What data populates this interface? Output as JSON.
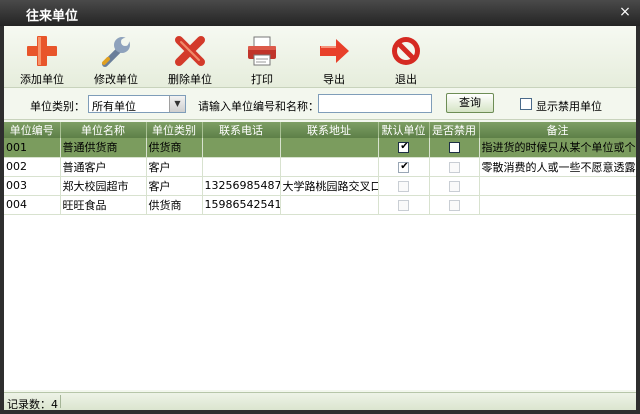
{
  "window": {
    "title": "往来单位",
    "close_glyph": "×"
  },
  "toolbar": {
    "add": {
      "label": "添加单位",
      "icon": "plus-icon",
      "color": "#e8552a"
    },
    "edit": {
      "label": "修改单位",
      "icon": "wrench-icon",
      "color": "#6a7f9a"
    },
    "delete": {
      "label": "删除单位",
      "icon": "x-icon",
      "color": "#d33a2a"
    },
    "print": {
      "label": "打印",
      "icon": "printer-icon",
      "color": "#c0342a"
    },
    "export": {
      "label": "导出",
      "icon": "arrow-right-icon",
      "color": "#e8402a"
    },
    "exit": {
      "label": "退出",
      "icon": "no-entry-icon",
      "color": "#d52a22"
    }
  },
  "filter": {
    "type_label": "单位类别：",
    "type_value": "所有单位",
    "search_label": "请输入单位编号和名称：",
    "search_value": "",
    "search_button": "查询",
    "show_disabled_label": "显示禁用单位",
    "show_disabled_checked": false
  },
  "table": {
    "columns": [
      "单位编号",
      "单位名称",
      "单位类别",
      "联系电话",
      "联系地址",
      "默认单位",
      "是否禁用",
      "备注"
    ],
    "rows": [
      {
        "code": "001",
        "name": "普通供货商",
        "type": "供货商",
        "phone": "",
        "address": "",
        "default": true,
        "disabled": false,
        "note": "指进货的时候只从某个单位或个",
        "selected": true
      },
      {
        "code": "002",
        "name": "普通客户",
        "type": "客户",
        "phone": "",
        "address": "",
        "default": true,
        "disabled": false,
        "note": "零散消费的人或一些不愿意透露",
        "selected": false
      },
      {
        "code": "003",
        "name": "郑大校园超市",
        "type": "客户",
        "phone": "13256985487",
        "address": "大学路桃园路交叉口",
        "default": false,
        "disabled": false,
        "note": "",
        "selected": false
      },
      {
        "code": "004",
        "name": "旺旺食品",
        "type": "供货商",
        "phone": "15986542541",
        "address": "",
        "default": false,
        "disabled": false,
        "note": "",
        "selected": false
      }
    ]
  },
  "status": {
    "record_count_label": "记录数：4"
  },
  "colors": {
    "header_green": "#6a8c52",
    "selected_row": "#7b9c5e",
    "title_bar": "#2e2e2e"
  }
}
